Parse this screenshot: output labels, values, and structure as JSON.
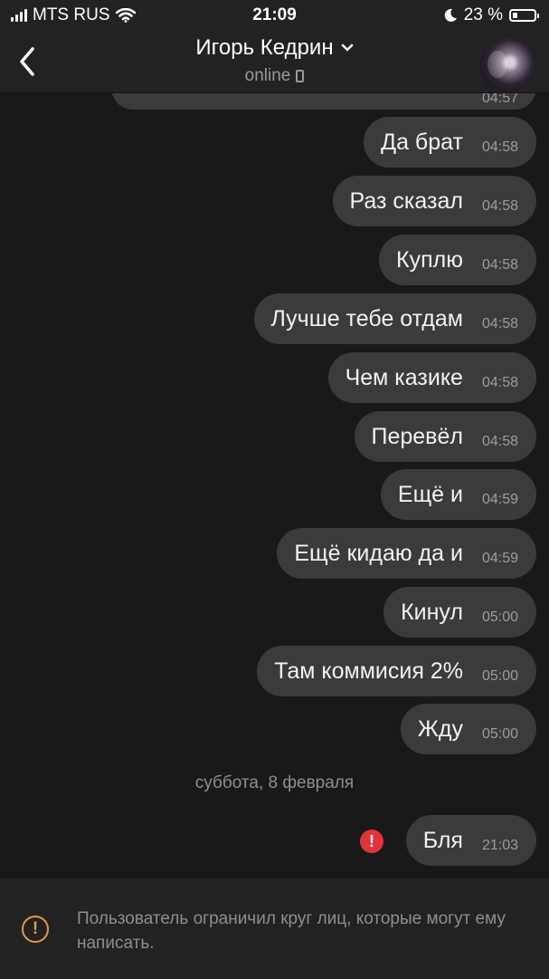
{
  "status_bar": {
    "carrier": "MTS RUS",
    "time": "21:09",
    "battery": "23 %"
  },
  "header": {
    "contact_name": "Игорь Кедрин",
    "presence": "online"
  },
  "messages": {
    "partial_time": "04:57",
    "items": [
      {
        "text": "Да брат",
        "time": "04:58"
      },
      {
        "text": "Раз сказал",
        "time": "04:58"
      },
      {
        "text": "Куплю",
        "time": "04:58"
      },
      {
        "text": "Лучше тебе отдам",
        "time": "04:58"
      },
      {
        "text": "Чем казике",
        "time": "04:58"
      },
      {
        "text": "Перевёл",
        "time": "04:58"
      },
      {
        "text": "Ещё и",
        "time": "04:59"
      },
      {
        "text": "Ещё кидаю да и",
        "time": "04:59"
      },
      {
        "text": "Кинул",
        "time": "05:00"
      },
      {
        "text": "Там коммисия 2%",
        "time": "05:00"
      },
      {
        "text": "Жду",
        "time": "05:00"
      }
    ],
    "date_separator": "суббота, 8 февраля",
    "failed_message": {
      "text": "Бля",
      "time": "21:03",
      "error_glyph": "!"
    }
  },
  "footer": {
    "notice": "Пользователь ограничил круг лиц, которые могут ему написать.",
    "warning_glyph": "!"
  },
  "colors": {
    "background": "#19191a",
    "bubble": "#3b3b3d",
    "error": "#e0343a",
    "warning": "#e39a3c"
  },
  "icons": [
    "signal-icon",
    "wifi-icon",
    "moon-icon",
    "battery-icon",
    "back-arrow-icon",
    "chevron-down-icon",
    "phone-icon",
    "error-icon",
    "warning-icon"
  ]
}
